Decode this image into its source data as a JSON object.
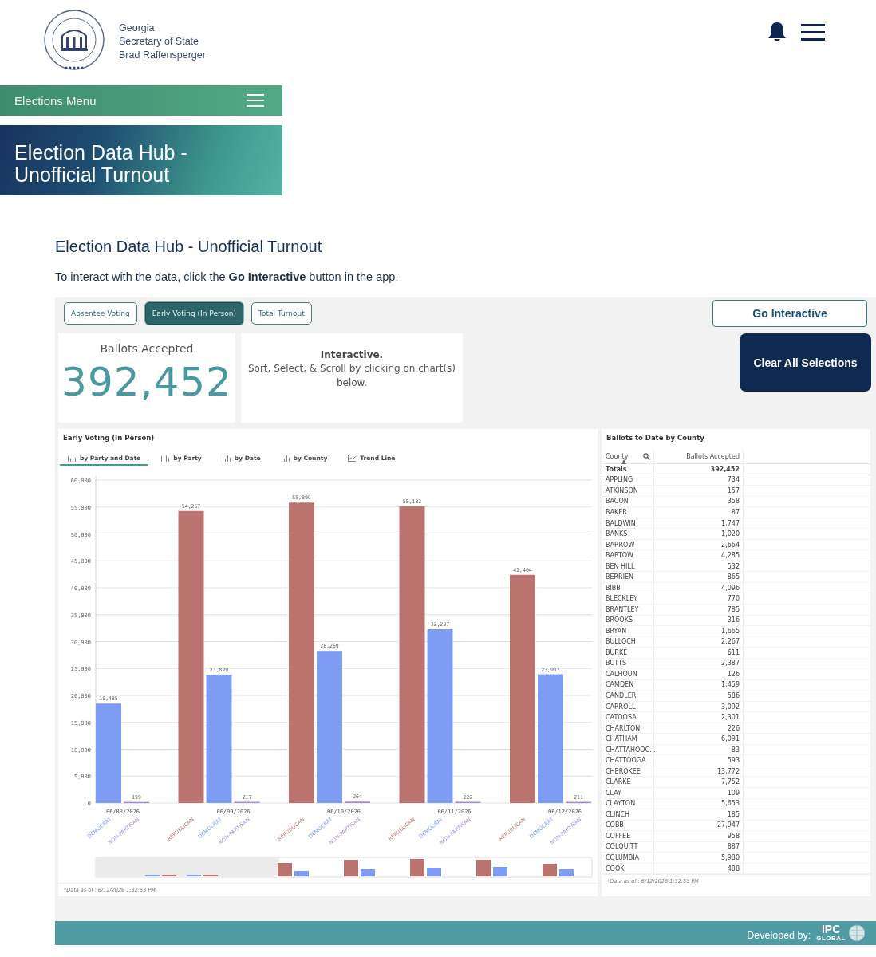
{
  "header": {
    "org_lines": [
      "Georgia",
      "Secretary of State",
      "Brad Raffensperger"
    ]
  },
  "elections_menu": {
    "label": "Elections Menu"
  },
  "hero": {
    "title": "Election Data Hub - Unofficial Turnout"
  },
  "page_title": "Election Data Hub - Unofficial Turnout",
  "intro": "To interact with the data, click the **Go Interactive** button in the app.",
  "app": {
    "view_buttons": [
      {
        "label": "Absentee Voting",
        "selected": false
      },
      {
        "label": "Early Voting (In Person)",
        "selected": true
      },
      {
        "label": "Total Turnout",
        "selected": false
      }
    ],
    "go_interactive": "Go Interactive",
    "kpi": {
      "label": "Ballots Accepted",
      "value": "392,452"
    },
    "info": {
      "title": "Interactive.",
      "text": "Sort, Select, & Scroll by clicking on chart(s) below."
    },
    "clear_button": "Clear All Selections",
    "chart_panel": {
      "title": "Early Voting (In Person)",
      "tabs": [
        {
          "label": "by Party and Date",
          "kind": "bar",
          "selected": true
        },
        {
          "label": "by Party",
          "kind": "bar",
          "selected": false
        },
        {
          "label": "by Date",
          "kind": "bar",
          "selected": false
        },
        {
          "label": "by County",
          "kind": "bar",
          "selected": false
        },
        {
          "label": "Trend Line",
          "kind": "line",
          "selected": false
        }
      ],
      "chart_data": {
        "type": "bar",
        "categories": [
          "06/08/2026",
          "06/09/2026",
          "06/10/2026",
          "06/11/2026",
          "06/12/2026"
        ],
        "series": [
          {
            "name": "REPUBLICAN",
            "color": "#bb736f",
            "values": [
              null,
              54257,
              55809,
              55102,
              42404
            ],
            "value_labels": [
              null,
              "54,257",
              "55,809",
              "55,102",
              "42,404"
            ]
          },
          {
            "name": "DEMOCRAT",
            "color": "#7f9cf5",
            "values": [
              18485,
              23820,
              28269,
              32297,
              23917
            ],
            "value_labels": [
              "18,485",
              "23,820",
              "28,269",
              "32,297",
              "23,917"
            ]
          },
          {
            "name": "NON-PARTISAN",
            "color": "#a68ad8",
            "values": [
              199,
              217,
              264,
              222,
              211
            ],
            "value_labels": [
              "199",
              "217",
              "264",
              "222",
              "211"
            ]
          }
        ],
        "ylim": [
          0,
          60000
        ],
        "yticks": [
          {
            "value": 0,
            "label": "0"
          },
          {
            "value": 5000,
            "label": "5,000"
          },
          {
            "value": 10000,
            "label": "10,000"
          },
          {
            "value": 15000,
            "label": "15,000"
          },
          {
            "value": 20000,
            "label": "20,000"
          },
          {
            "value": 25000,
            "label": "25,000"
          },
          {
            "value": 30000,
            "label": "30,000"
          },
          {
            "value": 35000,
            "label": "35,000"
          },
          {
            "value": 40000,
            "label": "40,000"
          },
          {
            "value": 45000,
            "label": "45,000"
          },
          {
            "value": 50000,
            "label": "50,000"
          },
          {
            "value": 55000,
            "label": "55,000"
          },
          {
            "value": 60000,
            "label": "60,000"
          }
        ],
        "grid": true
      },
      "note": "*Data as of : 6/12/2026 1:32:53 PM"
    },
    "table_panel": {
      "title": "Ballots to Date by County",
      "columns": [
        "County",
        "Ballots Accepted"
      ],
      "totals": {
        "label": "Totals",
        "value": "392,452"
      },
      "rows": [
        {
          "county": "APPLING",
          "ballots": "734"
        },
        {
          "county": "ATKINSON",
          "ballots": "157"
        },
        {
          "county": "BACON",
          "ballots": "358"
        },
        {
          "county": "BAKER",
          "ballots": "87"
        },
        {
          "county": "BALDWIN",
          "ballots": "1,747"
        },
        {
          "county": "BANKS",
          "ballots": "1,020"
        },
        {
          "county": "BARROW",
          "ballots": "2,664"
        },
        {
          "county": "BARTOW",
          "ballots": "4,285"
        },
        {
          "county": "BEN HILL",
          "ballots": "532"
        },
        {
          "county": "BERRIEN",
          "ballots": "865"
        },
        {
          "county": "BIBB",
          "ballots": "4,096"
        },
        {
          "county": "BLECKLEY",
          "ballots": "770"
        },
        {
          "county": "BRANTLEY",
          "ballots": "785"
        },
        {
          "county": "BROOKS",
          "ballots": "316"
        },
        {
          "county": "BRYAN",
          "ballots": "1,665"
        },
        {
          "county": "BULLOCH",
          "ballots": "2,267"
        },
        {
          "county": "BURKE",
          "ballots": "611"
        },
        {
          "county": "BUTTS",
          "ballots": "2,387"
        },
        {
          "county": "CALHOUN",
          "ballots": "126"
        },
        {
          "county": "CAMDEN",
          "ballots": "1,459"
        },
        {
          "county": "CANDLER",
          "ballots": "586"
        },
        {
          "county": "CARROLL",
          "ballots": "3,092"
        },
        {
          "county": "CATOOSA",
          "ballots": "2,301"
        },
        {
          "county": "CHARLTON",
          "ballots": "226"
        },
        {
          "county": "CHATHAM",
          "ballots": "6,091"
        },
        {
          "county": "CHATTAHOOC...",
          "ballots": "83"
        },
        {
          "county": "CHATTOOGA",
          "ballots": "593"
        },
        {
          "county": "CHEROKEE",
          "ballots": "13,772"
        },
        {
          "county": "CLARKE",
          "ballots": "7,752"
        },
        {
          "county": "CLAY",
          "ballots": "109"
        },
        {
          "county": "CLAYTON",
          "ballots": "5,653"
        },
        {
          "county": "CLINCH",
          "ballots": "185"
        },
        {
          "county": "COBB",
          "ballots": "27,947"
        },
        {
          "county": "COFFEE",
          "ballots": "958"
        },
        {
          "county": "COLQUITT",
          "ballots": "887"
        },
        {
          "county": "COLUMBIA",
          "ballots": "5,980"
        },
        {
          "county": "COOK",
          "ballots": "488"
        }
      ],
      "note": "*Data as of : 6/12/2026 1:32:53 PM"
    }
  },
  "footer": {
    "label": "Developed by:",
    "brand": "IPC",
    "brand_sub": "GLOBAL"
  }
}
